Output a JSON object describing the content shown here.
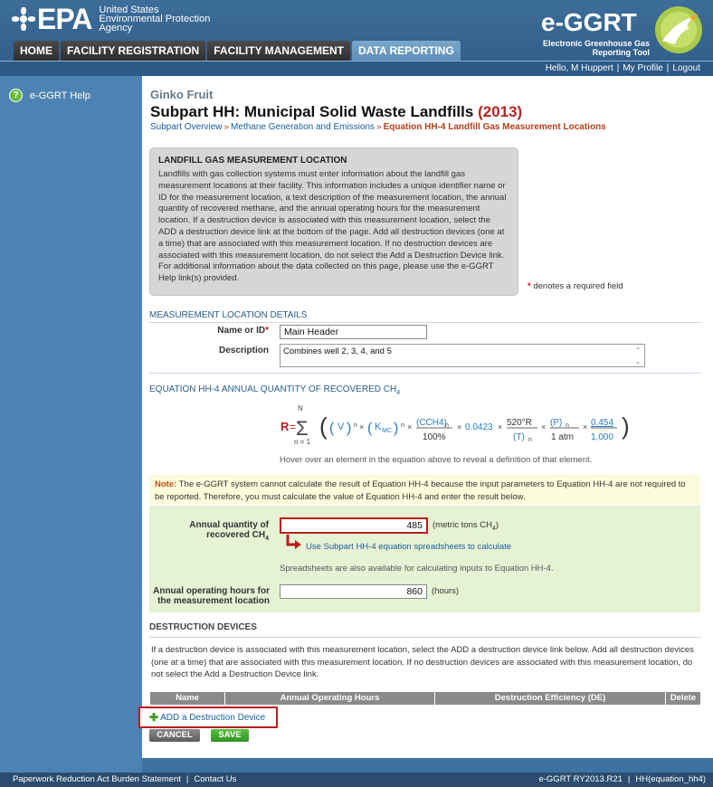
{
  "header": {
    "agency_lines": [
      "United States",
      "Environmental Protection",
      "Agency"
    ],
    "logo_text": "EPA",
    "app_logo": "e-GGRT",
    "app_subtitle_lines": [
      "Electronic Greenhouse Gas",
      "Reporting Tool"
    ]
  },
  "tabs": [
    {
      "label": "HOME",
      "active": false
    },
    {
      "label": "FACILITY REGISTRATION",
      "active": false
    },
    {
      "label": "FACILITY MANAGEMENT",
      "active": false
    },
    {
      "label": "DATA REPORTING",
      "active": true
    }
  ],
  "user": {
    "greeting": "Hello, M Huppert",
    "profile": "My Profile",
    "logout": "Logout"
  },
  "sidebar": {
    "help_label": "e-GGRT Help"
  },
  "page": {
    "facility": "Ginko Fruit",
    "title": "Subpart HH: Municipal Solid Waste Landfills",
    "year": "(2013)",
    "breadcrumb": {
      "overview": "Subpart Overview",
      "methane": "Methane Generation and Emissions",
      "current": "Equation HH-4 Landfill Gas Measurement Locations"
    }
  },
  "infobox": {
    "heading": "LANDFILL GAS MEASUREMENT LOCATION",
    "body": "Landfills with gas collection systems must enter information about the landfill gas measurement locations at their facility. This information includes a unique identifier name or ID for the measurement location, a text description of the measurement location, the annual quantity of recovered methane, and the annual operating hours for the measurement location. If a destruction device is associated with this measurement location, select the ADD a destruction device link at the bottom of the page. Add all destruction devices (one at a time) that are associated with this measurement location. If no destruction devices are associated with this measurement location, do not select the Add a Destruction Device link. For additional information about the data collected on this page, please use the e-GGRT Help link(s) provided."
  },
  "required_note": "denotes a required field",
  "details": {
    "heading": "MEASUREMENT LOCATION DETAILS",
    "name_label": "Name or ID",
    "name_value": "Main Header",
    "desc_label": "Description",
    "desc_value": "Combines well 2, 3, 4, and  5"
  },
  "equation": {
    "heading": "EQUATION HH-4 ANNUAL QUANTITY OF RECOVERED CH",
    "heading_sub": "4",
    "hover_note": "Hover over an element in the equation above to reveal a definition of that element."
  },
  "note": {
    "label": "Note:",
    "text": "The e-GGRT system cannot calculate the result of Equation HH-4 because the input parameters to Equation HH-4 are not required to be reported. Therefore, you must calculate the value of Equation HH-4 and enter the result below."
  },
  "annual": {
    "qty_label_1": "Annual quantity of",
    "qty_label_2": "recovered CH",
    "qty_label_sub": "4",
    "qty_value": "485",
    "qty_unit": "(metric tons CH",
    "qty_unit_sub": "4",
    "qty_unit_end": ")",
    "spreadsheet_link": "Use Subpart HH-4 equation spreadsheets to calculate",
    "spreadsheet_note": "Spreadsheets are also available for calculating inputs to Equation HH-4.",
    "hours_label_1": "Annual operating hours for",
    "hours_label_2": "the measurement location",
    "hours_value": "860",
    "hours_unit": "(hours)"
  },
  "destruction": {
    "heading": "DESTRUCTION DEVICES",
    "text": "If a destruction device is associated with this measurement location, select the ADD a destruction device link below. Add all destruction devices (one at a time) that are associated with this measurement location. If no destruction devices are associated with this measurement location, do not select the Add a Destruction Device link.",
    "columns": [
      "Name",
      "Annual Operating Hours",
      "Destruction Efficiency (DE)",
      "Delete"
    ],
    "add_link": "ADD a Destruction Device"
  },
  "buttons": {
    "cancel": "CANCEL",
    "save": "SAVE"
  },
  "footer": {
    "paperwork": "Paperwork Reduction Act Burden Statement",
    "contact": "Contact Us",
    "version": "e-GGRT RY2013.R21",
    "page_id": "HH(equation_hh4)"
  }
}
